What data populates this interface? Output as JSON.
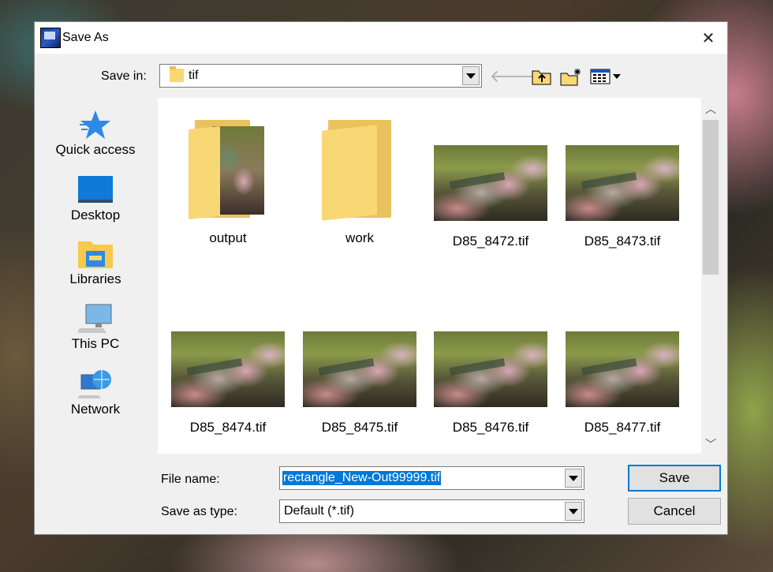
{
  "window": {
    "title": "Save As",
    "close_glyph": "✕"
  },
  "toolbar": {
    "save_in_label": "Save in:",
    "save_in_value": "tif",
    "back_glyph": "🡐"
  },
  "places": [
    {
      "label": "Quick access",
      "icon": "star-icon"
    },
    {
      "label": "Desktop",
      "icon": "desktop-icon"
    },
    {
      "label": "Libraries",
      "icon": "libraries-icon"
    },
    {
      "label": "This PC",
      "icon": "computer-icon"
    },
    {
      "label": "Network",
      "icon": "network-icon"
    }
  ],
  "files": [
    {
      "name": "output",
      "kind": "folder-with-image"
    },
    {
      "name": "work",
      "kind": "folder"
    },
    {
      "name": "D85_8472.tif",
      "kind": "image"
    },
    {
      "name": "D85_8473.tif",
      "kind": "image"
    },
    {
      "name": "D85_8474.tif",
      "kind": "image"
    },
    {
      "name": "D85_8475.tif",
      "kind": "image"
    },
    {
      "name": "D85_8476.tif",
      "kind": "image"
    },
    {
      "name": "D85_8477.tif",
      "kind": "image"
    }
  ],
  "form": {
    "file_name_label": "File name:",
    "file_name_value": "rectangle_New-Out99999.tif",
    "save_as_type_label": "Save as type:",
    "save_as_type_value": "Default (*.tif)"
  },
  "buttons": {
    "save": "Save",
    "cancel": "Cancel"
  },
  "colors": {
    "selection": "#0078d7",
    "folder": "#f8d775"
  }
}
